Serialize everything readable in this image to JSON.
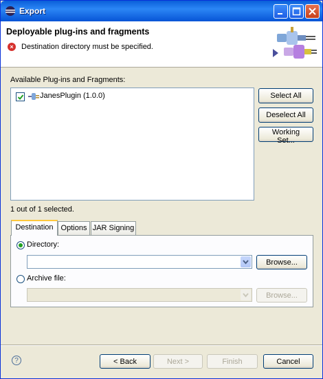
{
  "window": {
    "title": "Export"
  },
  "header": {
    "title": "Deployable plug-ins and fragments",
    "error": "Destination directory must be specified."
  },
  "plugins": {
    "label": "Available Plug-ins and Fragments:",
    "items": [
      {
        "label": "JanesPlugin (1.0.0)",
        "checked": true
      }
    ],
    "status": "1 out of 1 selected."
  },
  "side_buttons": {
    "select_all": "Select All",
    "deselect_all": "Deselect All",
    "working_set": "Working Set..."
  },
  "tabs": {
    "destination": "Destination",
    "options": "Options",
    "jar_signing": "JAR Signing"
  },
  "destination": {
    "directory_label": "Directory:",
    "directory_value": "",
    "directory_selected": true,
    "browse1": "Browse...",
    "archive_label": "Archive file:",
    "archive_value": "",
    "browse2": "Browse..."
  },
  "footer": {
    "back": "< Back",
    "next": "Next >",
    "finish": "Finish",
    "cancel": "Cancel"
  },
  "icons": {
    "window_icon": "eclipse-icon",
    "error_icon": "error-icon",
    "help_icon": "help-icon",
    "banner": "plugin-export-banner-icon",
    "plugin_icon": "plugin-icon"
  }
}
